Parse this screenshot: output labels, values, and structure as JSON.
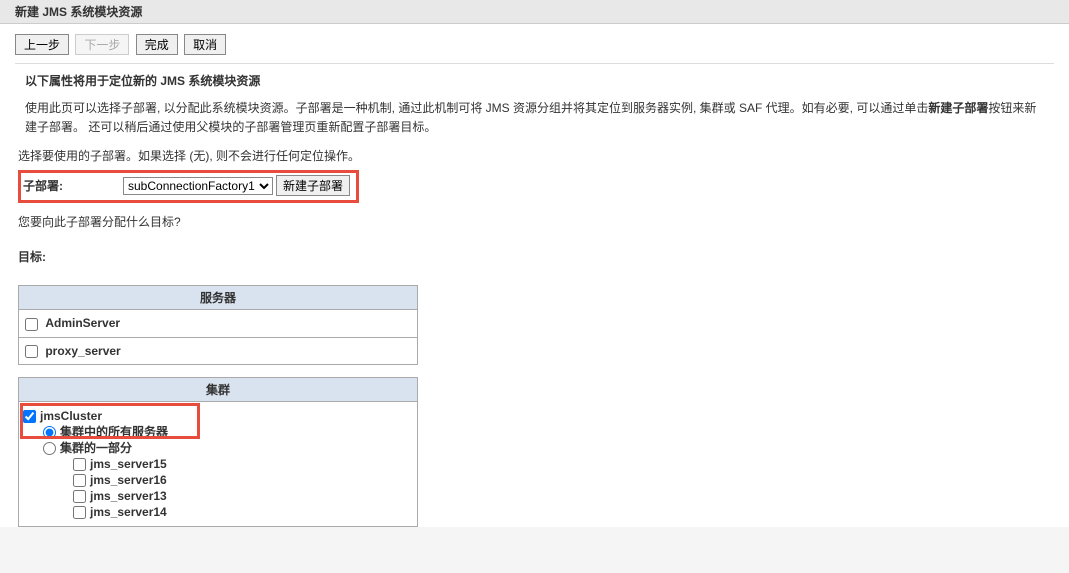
{
  "header": {
    "title": "新建 JMS 系统模块资源"
  },
  "buttons": {
    "back": "上一步",
    "next": "下一步",
    "finish": "完成",
    "cancel": "取消"
  },
  "section_heading": "以下属性将用于定位新的 JMS 系统模块资源",
  "description_part1": "使用此页可以选择子部署, 以分配此系统模块资源。子部署是一种机制, 通过此机制可将 JMS 资源分组并将其定位到服务器实例, 集群或 SAF 代理。如有必要, 可以通过单击",
  "description_bold": "新建子部署",
  "description_part2": "按钮来新建子部署。 还可以稍后通过使用父模块的子部署管理页重新配置子部署目标。",
  "instruction_select": "选择要使用的子部署。如果选择 (无), 则不会进行任何定位操作。",
  "form": {
    "subdeploy_label": "子部署:",
    "subdeploy_selected": "subConnectionFactory1",
    "new_subdeploy_btn": "新建子部署"
  },
  "question": "您要向此子部署分配什么目标?",
  "targets_label": "目标:",
  "servers_group": {
    "header": "服务器",
    "items": [
      {
        "name": "AdminServer",
        "checked": false
      },
      {
        "name": "proxy_server",
        "checked": false
      }
    ]
  },
  "clusters_group": {
    "header": "集群",
    "cluster": {
      "name": "jmsCluster",
      "checked": true,
      "radio_options": {
        "all": "集群中的所有服务器",
        "partial": "集群的一部分"
      },
      "radio_selected": "all",
      "partial_servers": [
        {
          "name": "jms_server15",
          "checked": false
        },
        {
          "name": "jms_server16",
          "checked": false
        },
        {
          "name": "jms_server13",
          "checked": false
        },
        {
          "name": "jms_server14",
          "checked": false
        }
      ]
    }
  }
}
